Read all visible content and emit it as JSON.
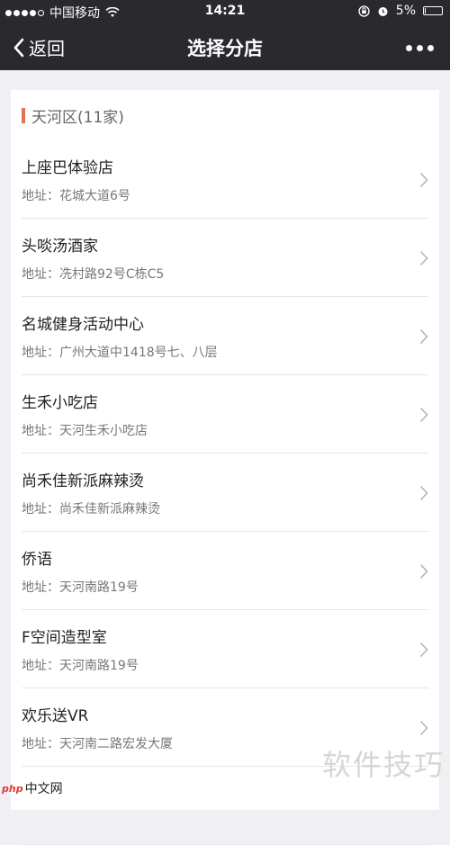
{
  "status_bar": {
    "carrier": "中国移动",
    "time": "14:21",
    "battery": "5%",
    "battery_level": 0.05
  },
  "navbar": {
    "back_label": "返回",
    "title": "选择分店"
  },
  "section": {
    "title": "天河区(11家)"
  },
  "stores": [
    {
      "name": "上座巴体验店",
      "address": "地址：花城大道6号"
    },
    {
      "name": "头啖汤酒家",
      "address": "地址：冼村路92号C栋C5"
    },
    {
      "name": "名城健身活动中心",
      "address": "地址：广州大道中1418号七、八层"
    },
    {
      "name": "生禾小吃店",
      "address": "地址：天河生禾小吃店"
    },
    {
      "name": "尚禾佳新派麻辣烫",
      "address": "地址：尚禾佳新派麻辣烫"
    },
    {
      "name": "侨语",
      "address": "地址：天河南路19号"
    },
    {
      "name": "F空间造型室",
      "address": "地址：天河南路19号"
    },
    {
      "name": "欢乐送VR",
      "address": "地址：天河南二路宏发大厦"
    },
    {
      "name": "",
      "address": ""
    }
  ],
  "watermark": {
    "text": "软件技巧",
    "logo_badge": "php",
    "logo_text": "中文网"
  }
}
